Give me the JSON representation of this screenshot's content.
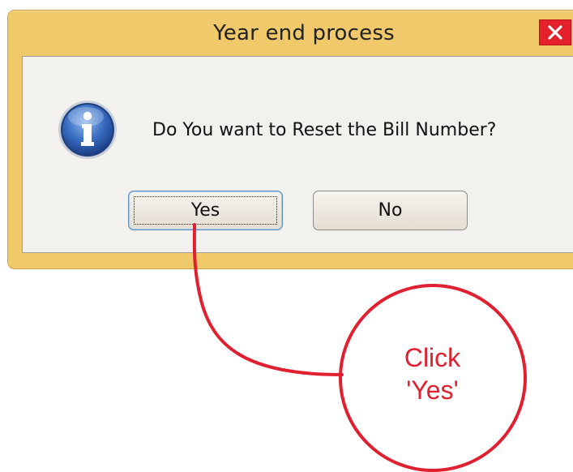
{
  "dialog": {
    "title": "Year end process",
    "message": "Do You want to Reset the Bill Number?",
    "icon": "info-icon",
    "buttons": {
      "yes": "Yes",
      "no": "No"
    },
    "close_icon": "close-icon"
  },
  "annotation": {
    "line1": "Click",
    "line2": "'Yes'",
    "color": "#e02030"
  },
  "colors": {
    "titlebar": "#f0c96a",
    "close_button": "#e4202a",
    "content_bg": "#f2f1ed"
  }
}
